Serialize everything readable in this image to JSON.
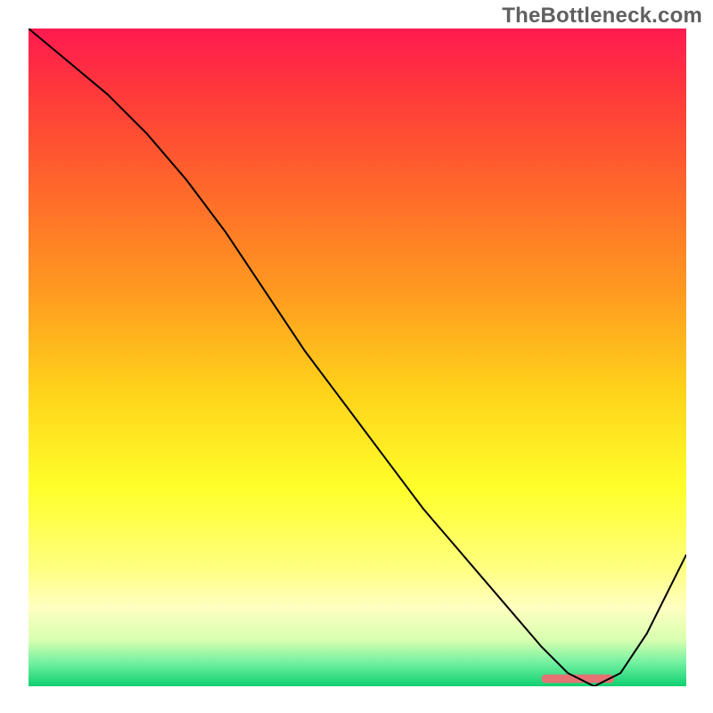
{
  "watermark": "TheBottleneck.com",
  "chart_data": {
    "type": "line",
    "title": "",
    "xlabel": "",
    "ylabel": "",
    "xlim": [
      0,
      100
    ],
    "ylim": [
      0,
      100
    ],
    "grid": false,
    "background_gradient": {
      "stops": [
        {
          "offset": 0.0,
          "color": "#ff1a50"
        },
        {
          "offset": 0.1,
          "color": "#ff3a3a"
        },
        {
          "offset": 0.25,
          "color": "#ff6a2a"
        },
        {
          "offset": 0.4,
          "color": "#ff9a20"
        },
        {
          "offset": 0.55,
          "color": "#ffd21a"
        },
        {
          "offset": 0.7,
          "color": "#ffff2a"
        },
        {
          "offset": 0.82,
          "color": "#ffff80"
        },
        {
          "offset": 0.88,
          "color": "#ffffc0"
        },
        {
          "offset": 0.93,
          "color": "#d8ffb0"
        },
        {
          "offset": 0.965,
          "color": "#70f0a0"
        },
        {
          "offset": 1.0,
          "color": "#10d070"
        }
      ]
    },
    "series": [
      {
        "name": "bottleneck-curve",
        "x": [
          0,
          6,
          12,
          18,
          24,
          30,
          36,
          42,
          48,
          54,
          60,
          66,
          72,
          78,
          82,
          86,
          90,
          94,
          100
        ],
        "y": [
          100,
          95,
          90,
          84,
          77,
          69,
          60,
          51,
          43,
          35,
          27,
          20,
          13,
          6,
          2,
          0,
          2,
          8,
          20
        ],
        "color": "#000000"
      }
    ],
    "marker_band": {
      "x_start": 78,
      "x_end": 89,
      "y": 1.2,
      "color": "#e57373"
    }
  }
}
